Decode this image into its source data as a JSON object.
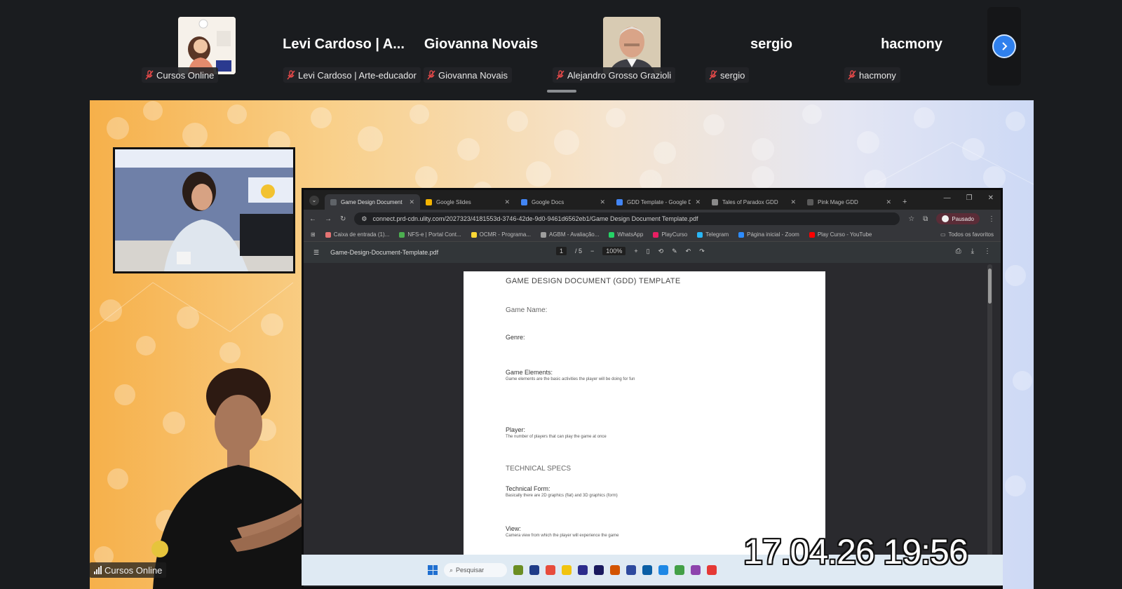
{
  "participants": [
    {
      "id": "cursos",
      "display": "avatar",
      "chip_label": "Cursos Online"
    },
    {
      "id": "levi",
      "display": "name",
      "big_name": "Levi Cardoso | A...",
      "chip_label": "Levi Cardoso | Arte-educador"
    },
    {
      "id": "giovanna",
      "display": "name",
      "big_name": "Giovanna Novais",
      "chip_label": "Giovanna Novais"
    },
    {
      "id": "alejandro",
      "display": "avatar",
      "chip_label": "Alejandro Grosso Grazioli"
    },
    {
      "id": "sergio",
      "display": "name",
      "big_name": "sergio",
      "chip_label": "sergio"
    },
    {
      "id": "hacmony",
      "display": "name",
      "big_name": "hacmony",
      "chip_label": "hacmony"
    }
  ],
  "strip_next_icon": "chevron-right-icon",
  "mic_icon": "mic-off-icon",
  "browser": {
    "tabs": [
      {
        "label": "Game Design Document",
        "color": "#3c3c3c"
      },
      {
        "label": "Google Slides",
        "color": "#f4b400"
      },
      {
        "label": "Google Docs",
        "color": "#4285f4"
      },
      {
        "label": "GDD Template - Google Do...",
        "color": "#4285f4"
      },
      {
        "label": "Tales of Paradox GDD",
        "color": "#8a8a8a"
      },
      {
        "label": "Pink Mage GDD",
        "color": "#5a5a5a"
      }
    ],
    "url": "connect.prd-cdn.ulity.com/2027323/4181553d-3746-42de-9d0-9461d6562eb1/Game Design Document Template.pdf",
    "profile_label": "Pausado",
    "bookmarks": [
      {
        "label": "Caixa de entrada (1)...",
        "color": "#e57373"
      },
      {
        "label": "NFS-e | Portal Cont...",
        "color": "#4caf50"
      },
      {
        "label": "OCMR - Programa...",
        "color": "#fdd835"
      },
      {
        "label": "AGBM - Avaliação...",
        "color": "#9e9e9e"
      },
      {
        "label": "WhatsApp",
        "color": "#25d366"
      },
      {
        "label": "PlayCurso",
        "color": "#e91e63"
      },
      {
        "label": "Telegram",
        "color": "#29b6f6"
      },
      {
        "label": "Página inicial - Zoom",
        "color": "#2d8cff"
      },
      {
        "label": "Play Curso - YouTube",
        "color": "#ff0000"
      }
    ],
    "bookmarks_right": "Todos os favoritos",
    "pdf": {
      "filename": "Game-Design-Document-Template.pdf",
      "page_current": "1",
      "page_total": "/ 5",
      "zoom": "100%"
    }
  },
  "document": {
    "title": "GAME DESIGN DOCUMENT (GDD) TEMPLATE",
    "game_name_label": "Game Name:",
    "genre_label": "Genre:",
    "game_elements_label": "Game Elements:",
    "game_elements_desc": "Game elements are the basic activities the player will be doing for fun",
    "player_label": "Player:",
    "player_desc": "The number of players that can play the game at once",
    "tech_heading": "TECHNICAL SPECS",
    "tech_form_label": "Technical Form:",
    "tech_form_desc": "Basically there are 2D graphics (flat) and 3D graphics (form)",
    "view_label": "View:",
    "view_desc": "Camera view from which the player will experience the game"
  },
  "taskbar": {
    "search_placeholder": "Pesquisar"
  },
  "timestamp": "17.04.26 19:56",
  "host_label": "Cursos Online"
}
